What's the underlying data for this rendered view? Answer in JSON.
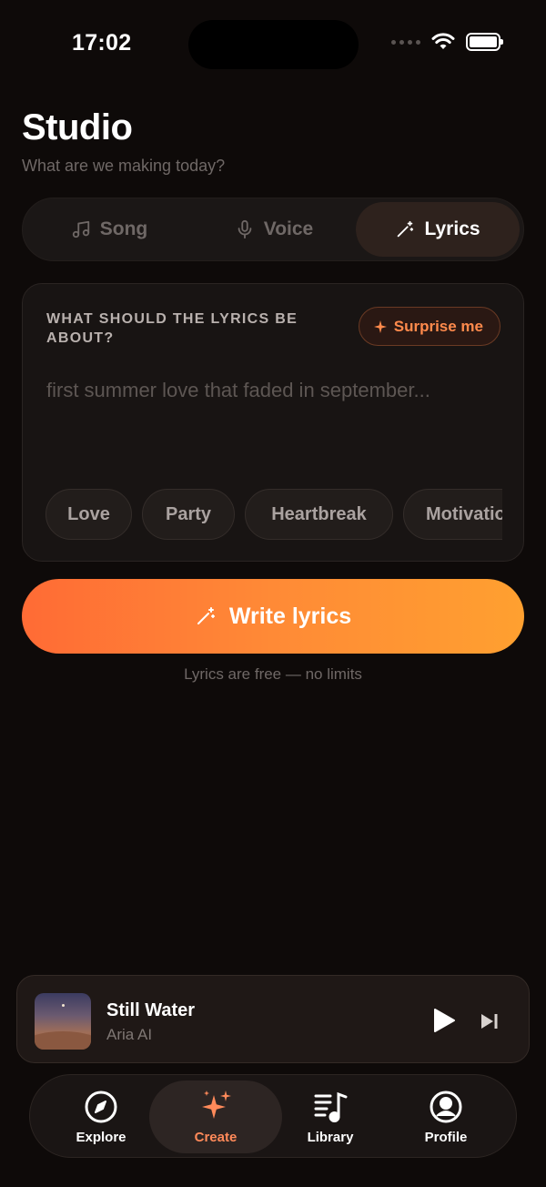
{
  "status": {
    "time": "17:02"
  },
  "header": {
    "title": "Studio",
    "subtitle": "What are we making today?"
  },
  "modes": [
    {
      "label": "Song",
      "icon": "music-note-icon",
      "selected": false
    },
    {
      "label": "Voice",
      "icon": "microphone-icon",
      "selected": false
    },
    {
      "label": "Lyrics",
      "icon": "magic-wand-icon",
      "selected": true
    }
  ],
  "prompt": {
    "label": "WHAT SHOULD THE LYRICS BE ABOUT?",
    "surprise_label": "Surprise me",
    "placeholder": "first summer love that faded in september...",
    "chips": [
      "Love",
      "Party",
      "Heartbreak",
      "Motivation"
    ]
  },
  "cta": {
    "label": "Write lyrics",
    "note": "Lyrics are free — no limits"
  },
  "player": {
    "title": "Still Water",
    "artist": "Aria AI"
  },
  "tabs": [
    {
      "label": "Explore",
      "icon": "compass-icon",
      "selected": false
    },
    {
      "label": "Create",
      "icon": "sparkles-icon",
      "selected": true
    },
    {
      "label": "Library",
      "icon": "library-icon",
      "selected": false
    },
    {
      "label": "Profile",
      "icon": "profile-icon",
      "selected": false
    }
  ],
  "colors": {
    "accent": "#ff7a3d",
    "accent_end": "#ffa030",
    "background": "#0e0a09"
  }
}
